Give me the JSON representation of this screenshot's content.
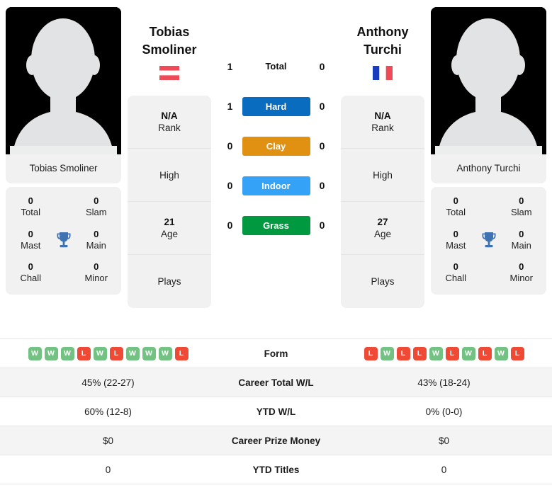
{
  "players": {
    "left": {
      "name_line1": "Tobias",
      "name_line2": "Smoliner",
      "full_name": "Tobias Smoliner",
      "country": "Austria",
      "flag": "austria-flag",
      "avatar": "player-avatar-placeholder",
      "info": [
        {
          "value": "N/A",
          "caption": "Rank"
        },
        {
          "value": "",
          "caption": "High"
        },
        {
          "value": "21",
          "caption": "Age"
        },
        {
          "value": "",
          "caption": "Plays"
        }
      ],
      "titles": [
        {
          "num": "0",
          "label": "Total"
        },
        {
          "num": "0",
          "label": "Slam"
        },
        {
          "num": "0",
          "label": "Mast"
        },
        {
          "num": "0",
          "label": "Main"
        },
        {
          "num": "0",
          "label": "Chall"
        },
        {
          "num": "0",
          "label": "Minor"
        }
      ],
      "form": [
        "W",
        "W",
        "W",
        "L",
        "W",
        "L",
        "W",
        "W",
        "W",
        "L"
      ],
      "career_total_wl": "45% (22-27)",
      "ytd_wl": "60% (12-8)",
      "career_prize_money": "$0",
      "ytd_titles": "0"
    },
    "right": {
      "name_line1": "Anthony",
      "name_line2": "Turchi",
      "full_name": "Anthony Turchi",
      "country": "France",
      "flag": "france-flag",
      "avatar": "player-avatar-placeholder",
      "info": [
        {
          "value": "N/A",
          "caption": "Rank"
        },
        {
          "value": "",
          "caption": "High"
        },
        {
          "value": "27",
          "caption": "Age"
        },
        {
          "value": "",
          "caption": "Plays"
        }
      ],
      "titles": [
        {
          "num": "0",
          "label": "Total"
        },
        {
          "num": "0",
          "label": "Slam"
        },
        {
          "num": "0",
          "label": "Mast"
        },
        {
          "num": "0",
          "label": "Main"
        },
        {
          "num": "0",
          "label": "Chall"
        },
        {
          "num": "0",
          "label": "Minor"
        }
      ],
      "form": [
        "L",
        "W",
        "L",
        "L",
        "W",
        "L",
        "W",
        "L",
        "W",
        "L"
      ],
      "career_total_wl": "43% (18-24)",
      "ytd_wl": "0% (0-0)",
      "career_prize_money": "$0",
      "ytd_titles": "0"
    }
  },
  "head_to_head": [
    {
      "label": "Total",
      "left": "1",
      "right": "0",
      "style": "plain",
      "color": ""
    },
    {
      "label": "Hard",
      "left": "1",
      "right": "0",
      "style": "badge",
      "color": "#0a6cbf"
    },
    {
      "label": "Clay",
      "left": "0",
      "right": "0",
      "style": "badge",
      "color": "#e09112"
    },
    {
      "label": "Indoor",
      "left": "0",
      "right": "0",
      "style": "badge",
      "color": "#34a3f7"
    },
    {
      "label": "Grass",
      "left": "0",
      "right": "0",
      "style": "badge",
      "color": "#00993f"
    }
  ],
  "stats_rows": [
    {
      "label": "Form",
      "key": "form"
    },
    {
      "label": "Career Total W/L",
      "key": "career_total_wl"
    },
    {
      "label": "YTD W/L",
      "key": "ytd_wl"
    },
    {
      "label": "Career Prize Money",
      "key": "career_prize_money"
    },
    {
      "label": "YTD Titles",
      "key": "ytd_titles"
    }
  ],
  "theme": {
    "card_bg": "#f1f1f1",
    "row_alt_bg": "#f4f4f4",
    "win_color": "#74c283",
    "loss_color": "#ef4a36",
    "trophy_color": "#3f72b0"
  }
}
